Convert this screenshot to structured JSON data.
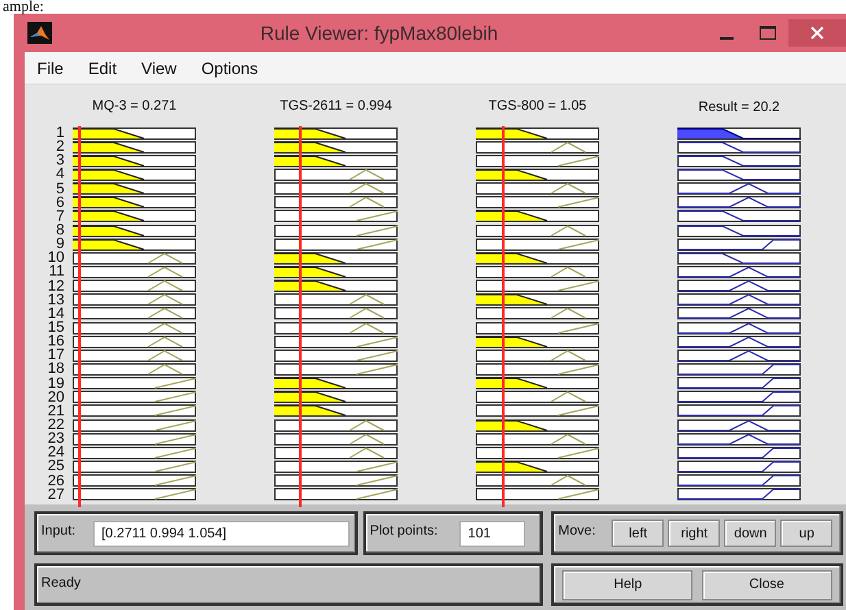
{
  "page_text": "ample:",
  "window": {
    "title": "Rule Viewer: fypMax80lebih"
  },
  "menu": [
    "File",
    "Edit",
    "View",
    "Options"
  ],
  "variables": [
    {
      "label": "MQ-3 = 0.271",
      "kind": "input"
    },
    {
      "label": "TGS-2611 = 0.994",
      "kind": "input"
    },
    {
      "label": "TGS-800 = 1.05",
      "kind": "input"
    },
    {
      "label": "Result = 20.2",
      "kind": "output"
    }
  ],
  "rules": [
    {
      "number": "1",
      "mfs": [
        {
          "kind": "z",
          "fired": true
        },
        {
          "kind": "z",
          "fired": true
        },
        {
          "kind": "z",
          "fired": true
        },
        {
          "kind": "z",
          "fired": true
        }
      ]
    },
    {
      "number": "2",
      "mfs": [
        {
          "kind": "z",
          "fired": true
        },
        {
          "kind": "z",
          "fired": true
        },
        {
          "kind": "tri",
          "fired": false
        },
        {
          "kind": "z",
          "fired": false
        }
      ]
    },
    {
      "number": "3",
      "mfs": [
        {
          "kind": "z",
          "fired": true
        },
        {
          "kind": "z",
          "fired": true
        },
        {
          "kind": "s",
          "fired": false
        },
        {
          "kind": "z",
          "fired": false
        }
      ]
    },
    {
      "number": "4",
      "mfs": [
        {
          "kind": "z",
          "fired": true
        },
        {
          "kind": "tri",
          "fired": false
        },
        {
          "kind": "z",
          "fired": true
        },
        {
          "kind": "z",
          "fired": false
        }
      ]
    },
    {
      "number": "5",
      "mfs": [
        {
          "kind": "z",
          "fired": true
        },
        {
          "kind": "tri",
          "fired": false
        },
        {
          "kind": "tri",
          "fired": false
        },
        {
          "kind": "tri",
          "fired": false
        }
      ]
    },
    {
      "number": "6",
      "mfs": [
        {
          "kind": "z",
          "fired": true
        },
        {
          "kind": "tri",
          "fired": false
        },
        {
          "kind": "s",
          "fired": false
        },
        {
          "kind": "tri",
          "fired": false
        }
      ]
    },
    {
      "number": "7",
      "mfs": [
        {
          "kind": "z",
          "fired": true
        },
        {
          "kind": "s",
          "fired": false
        },
        {
          "kind": "z",
          "fired": true
        },
        {
          "kind": "z",
          "fired": false
        }
      ]
    },
    {
      "number": "8",
      "mfs": [
        {
          "kind": "z",
          "fired": true
        },
        {
          "kind": "s",
          "fired": false
        },
        {
          "kind": "tri",
          "fired": false
        },
        {
          "kind": "z",
          "fired": false
        }
      ]
    },
    {
      "number": "9",
      "mfs": [
        {
          "kind": "z",
          "fired": true
        },
        {
          "kind": "s",
          "fired": false
        },
        {
          "kind": "s",
          "fired": false
        },
        {
          "kind": "s",
          "fired": false
        }
      ]
    },
    {
      "number": "10",
      "mfs": [
        {
          "kind": "tri",
          "fired": false
        },
        {
          "kind": "z",
          "fired": true
        },
        {
          "kind": "z",
          "fired": true
        },
        {
          "kind": "z",
          "fired": false
        }
      ]
    },
    {
      "number": "11",
      "mfs": [
        {
          "kind": "tri",
          "fired": false
        },
        {
          "kind": "z",
          "fired": true
        },
        {
          "kind": "tri",
          "fired": false
        },
        {
          "kind": "tri",
          "fired": false
        }
      ]
    },
    {
      "number": "12",
      "mfs": [
        {
          "kind": "tri",
          "fired": false
        },
        {
          "kind": "z",
          "fired": true
        },
        {
          "kind": "s",
          "fired": false
        },
        {
          "kind": "tri",
          "fired": false
        }
      ]
    },
    {
      "number": "13",
      "mfs": [
        {
          "kind": "tri",
          "fired": false
        },
        {
          "kind": "tri",
          "fired": false
        },
        {
          "kind": "z",
          "fired": true
        },
        {
          "kind": "tri",
          "fired": false
        }
      ]
    },
    {
      "number": "14",
      "mfs": [
        {
          "kind": "tri",
          "fired": false
        },
        {
          "kind": "tri",
          "fired": false
        },
        {
          "kind": "tri",
          "fired": false
        },
        {
          "kind": "tri",
          "fired": false
        }
      ]
    },
    {
      "number": "15",
      "mfs": [
        {
          "kind": "tri",
          "fired": false
        },
        {
          "kind": "tri",
          "fired": false
        },
        {
          "kind": "s",
          "fired": false
        },
        {
          "kind": "tri",
          "fired": false
        }
      ]
    },
    {
      "number": "16",
      "mfs": [
        {
          "kind": "tri",
          "fired": false
        },
        {
          "kind": "s",
          "fired": false
        },
        {
          "kind": "z",
          "fired": true
        },
        {
          "kind": "tri",
          "fired": false
        }
      ]
    },
    {
      "number": "17",
      "mfs": [
        {
          "kind": "tri",
          "fired": false
        },
        {
          "kind": "s",
          "fired": false
        },
        {
          "kind": "tri",
          "fired": false
        },
        {
          "kind": "tri",
          "fired": false
        }
      ]
    },
    {
      "number": "18",
      "mfs": [
        {
          "kind": "tri",
          "fired": false
        },
        {
          "kind": "s",
          "fired": false
        },
        {
          "kind": "s",
          "fired": false
        },
        {
          "kind": "s",
          "fired": false
        }
      ]
    },
    {
      "number": "19",
      "mfs": [
        {
          "kind": "s",
          "fired": false
        },
        {
          "kind": "z",
          "fired": true
        },
        {
          "kind": "z",
          "fired": true
        },
        {
          "kind": "s",
          "fired": false
        }
      ]
    },
    {
      "number": "20",
      "mfs": [
        {
          "kind": "s",
          "fired": false
        },
        {
          "kind": "z",
          "fired": true
        },
        {
          "kind": "tri",
          "fired": false
        },
        {
          "kind": "s",
          "fired": false
        }
      ]
    },
    {
      "number": "21",
      "mfs": [
        {
          "kind": "s",
          "fired": false
        },
        {
          "kind": "z",
          "fired": true
        },
        {
          "kind": "s",
          "fired": false
        },
        {
          "kind": "s",
          "fired": false
        }
      ]
    },
    {
      "number": "22",
      "mfs": [
        {
          "kind": "s",
          "fired": false
        },
        {
          "kind": "tri",
          "fired": false
        },
        {
          "kind": "z",
          "fired": true
        },
        {
          "kind": "tri",
          "fired": false
        }
      ]
    },
    {
      "number": "23",
      "mfs": [
        {
          "kind": "s",
          "fired": false
        },
        {
          "kind": "tri",
          "fired": false
        },
        {
          "kind": "tri",
          "fired": false
        },
        {
          "kind": "tri",
          "fired": false
        }
      ]
    },
    {
      "number": "24",
      "mfs": [
        {
          "kind": "s",
          "fired": false
        },
        {
          "kind": "tri",
          "fired": false
        },
        {
          "kind": "s",
          "fired": false
        },
        {
          "kind": "s",
          "fired": false
        }
      ]
    },
    {
      "number": "25",
      "mfs": [
        {
          "kind": "s",
          "fired": false
        },
        {
          "kind": "s",
          "fired": false
        },
        {
          "kind": "z",
          "fired": true
        },
        {
          "kind": "s",
          "fired": false
        }
      ]
    },
    {
      "number": "26",
      "mfs": [
        {
          "kind": "s",
          "fired": false
        },
        {
          "kind": "s",
          "fired": false
        },
        {
          "kind": "tri",
          "fired": false
        },
        {
          "kind": "s",
          "fired": false
        }
      ]
    },
    {
      "number": "27",
      "mfs": [
        {
          "kind": "s",
          "fired": false
        },
        {
          "kind": "s",
          "fired": false
        },
        {
          "kind": "s",
          "fired": false
        },
        {
          "kind": "s",
          "fired": false
        }
      ]
    }
  ],
  "input": {
    "label": "Input:",
    "value": "[0.2711 0.994 1.054]"
  },
  "plot_points": {
    "label": "Plot points:",
    "value": "101"
  },
  "move": {
    "label": "Move:",
    "buttons": [
      "left",
      "right",
      "down",
      "up"
    ]
  },
  "status": "Ready",
  "buttons": [
    "Help",
    "Close"
  ]
}
